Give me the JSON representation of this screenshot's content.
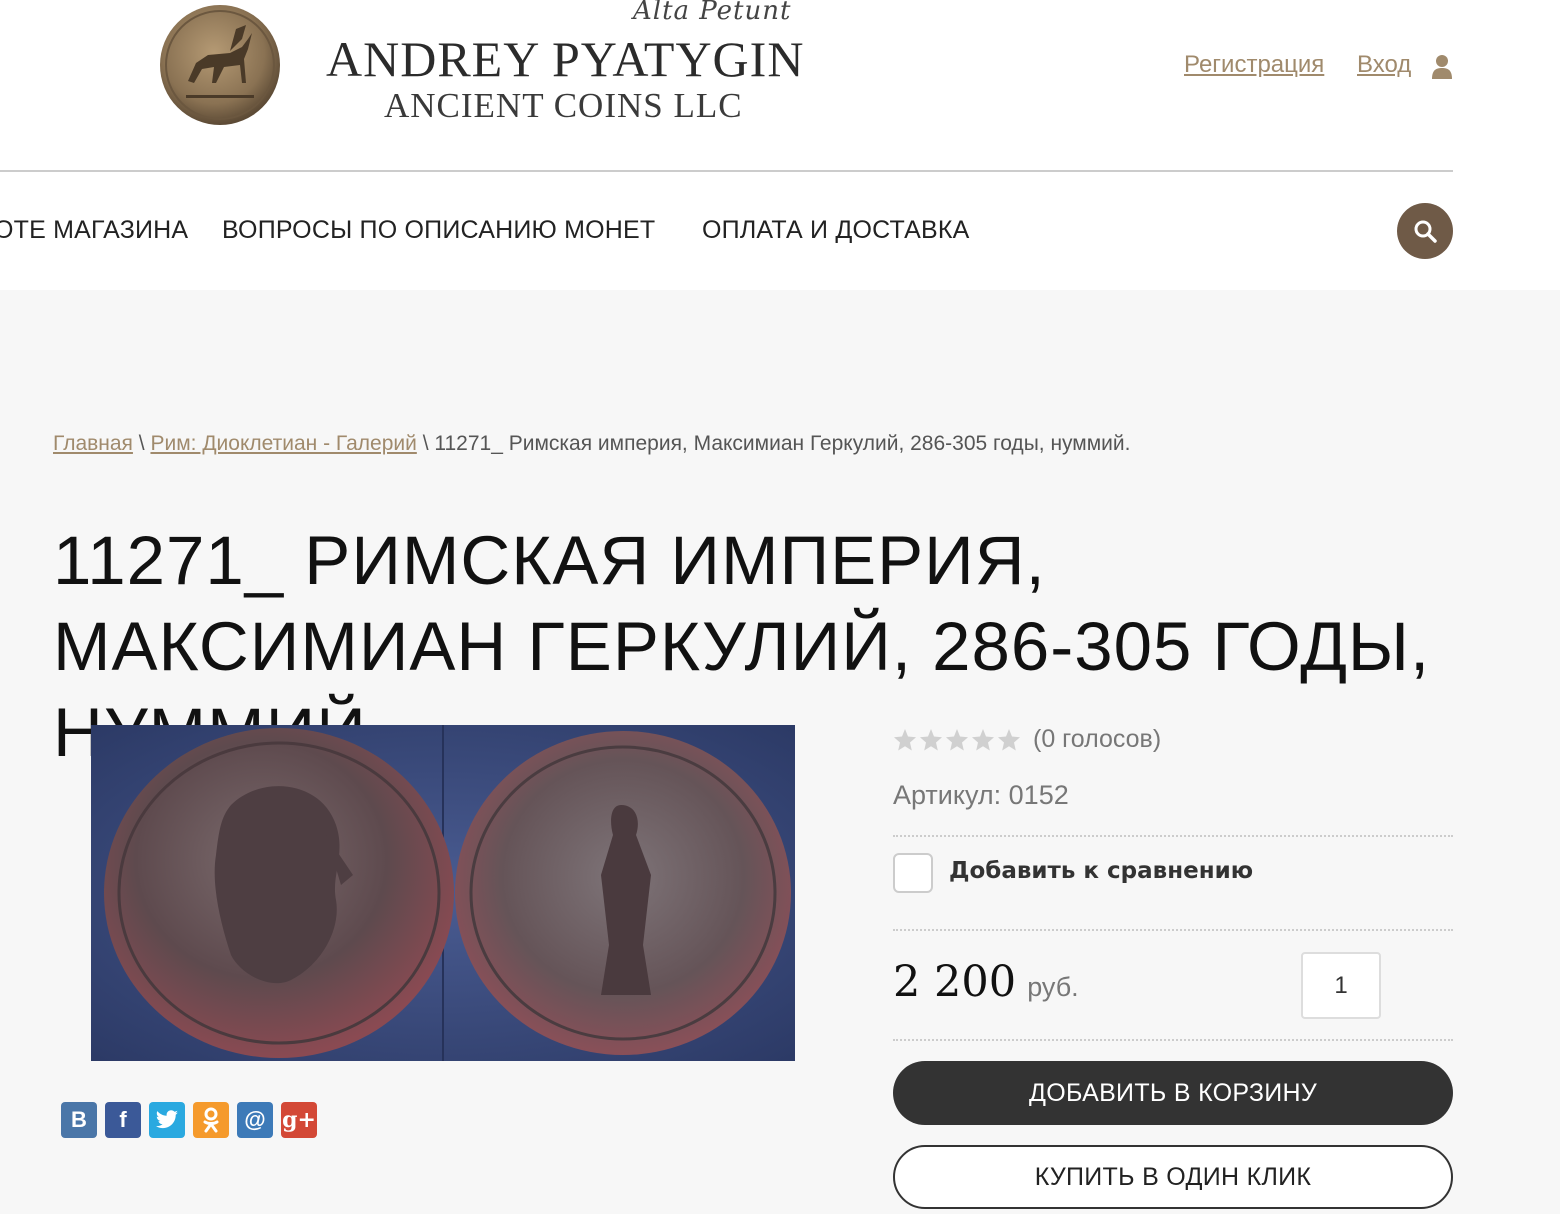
{
  "colors": {
    "accent_brown": "#6f5a47",
    "link_tan": "#a08a6c",
    "dark_button": "#333333"
  },
  "logo": {
    "motto": "Alta Petunt",
    "name": "ANDREY PYATYGIN",
    "subtitle": "ANCIENT COINS LLC"
  },
  "header": {
    "register_label": "Регистрация",
    "login_label": "Вход",
    "user_icon": "user-icon"
  },
  "nav": {
    "items": [
      {
        "label": "ОТЕ МАГАЗИНА"
      },
      {
        "label": "ВОПРОСЫ ПО ОПИСАНИЮ МОНЕТ"
      },
      {
        "label": "ОПЛАТА И ДОСТАВКА"
      }
    ],
    "search_icon": "search-icon"
  },
  "breadcrumb": {
    "home": "Главная",
    "separator": "\\",
    "category": "Рим: Диоклетиан - Галерий",
    "current": "11271_ Римская империя, Максимиан Геркулий, 286-305 годы, нуммий."
  },
  "product": {
    "title": "11271_ РИМСКАЯ ИМПЕРИЯ, МАКСИМИАН ГЕРКУЛИЙ, 286-305 ГОДЫ, НУММИЙ.",
    "rating": 0,
    "rating_max": 5,
    "votes_label": "(0 голосов)",
    "sku_label": "Артикул: 0152",
    "compare_label": "Добавить к сравнению",
    "price": "2 200",
    "currency": "руб.",
    "quantity": "1",
    "add_to_cart_label": "ДОБАВИТЬ В КОРЗИНУ",
    "buy_one_click_label": "КУПИТЬ В ОДИН КЛИК"
  },
  "share": [
    {
      "name": "vk-icon",
      "glyph": "В",
      "color": "#4a76a8"
    },
    {
      "name": "facebook-icon",
      "glyph": "f",
      "color": "#3b5998"
    },
    {
      "name": "twitter-icon",
      "glyph": "",
      "color": "#2aa9e0"
    },
    {
      "name": "odnoklassniki-icon",
      "glyph": "",
      "color": "#f59a2c"
    },
    {
      "name": "mailru-icon",
      "glyph": "@",
      "color": "#3d7ab8"
    },
    {
      "name": "googleplus-icon",
      "glyph": "g+",
      "color": "#d34836"
    }
  ]
}
